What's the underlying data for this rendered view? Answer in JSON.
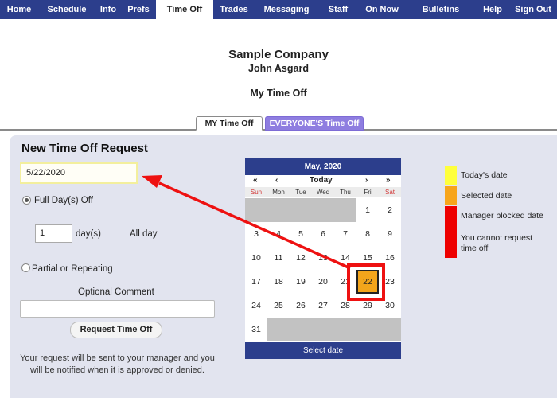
{
  "nav": {
    "items": [
      {
        "label": "Home",
        "width": 48,
        "active": false
      },
      {
        "label": "Schedule",
        "width": 72,
        "active": false
      },
      {
        "label": "Info",
        "width": 32,
        "active": false
      },
      {
        "label": "Prefs",
        "width": 44,
        "active": false
      },
      {
        "label": "Time Off",
        "width": 72,
        "active": true
      },
      {
        "label": "Trades",
        "width": 52,
        "active": false
      },
      {
        "label": "Messaging",
        "width": 80,
        "active": false
      },
      {
        "label": "Staff",
        "width": 50,
        "active": false
      },
      {
        "label": "On Now",
        "width": 60,
        "active": false
      },
      {
        "label": "Bulletins",
        "width": 88,
        "active": false
      },
      {
        "label": "Help",
        "width": 42,
        "active": false
      },
      {
        "label": "Sign Out",
        "width": 60,
        "active": false
      }
    ]
  },
  "header": {
    "company": "Sample Company",
    "user": "John Asgard",
    "title": "My Time Off"
  },
  "subtabs": {
    "mine": "MY Time Off",
    "everyone": "EVERYONE'S Time Off"
  },
  "form": {
    "title": "New Time Off Request",
    "date_value": "5/22/2020",
    "full_day_label": "Full Day(s) Off",
    "days_value": "1",
    "days_unit": "day(s)",
    "all_day": "All day",
    "partial_label": "Partial or Repeating",
    "comment_label": "Optional Comment",
    "submit_label": "Request Time Off",
    "notice": "Your request will be sent to your manager and you will be notified when it is approved or denied."
  },
  "calendar": {
    "month_label": "May, 2020",
    "nav": {
      "prev_year": "«",
      "prev_month": "‹",
      "today": "Today",
      "next_month": "›",
      "next_year": "»"
    },
    "days_of_week": [
      "Sun",
      "Mon",
      "Tue",
      "Wed",
      "Thu",
      "Fri",
      "Sat"
    ],
    "weeks": [
      [
        "",
        "",
        "",
        "",
        "",
        "1",
        "2"
      ],
      [
        "3",
        "4",
        "5",
        "6",
        "7",
        "8",
        "9"
      ],
      [
        "10",
        "11",
        "12",
        "13",
        "14",
        "15",
        "16"
      ],
      [
        "17",
        "18",
        "19",
        "20",
        "21",
        "22",
        "23"
      ],
      [
        "24",
        "25",
        "26",
        "27",
        "28",
        "29",
        "30"
      ],
      [
        "31",
        "",
        "",
        "",
        "",
        "",
        ""
      ]
    ],
    "selected_day": "22",
    "footer": "Select date",
    "colors": {
      "header": "#2c3e8c",
      "blank": "#c2c2c2",
      "selected": "#f3a51b"
    }
  },
  "legend": {
    "todays_date": "Today's date",
    "selected_date": "Selected date",
    "blocked": "Manager blocked date",
    "blocked_note": "You cannot request time off",
    "colors": {
      "today": "#ffff3c",
      "selected": "#f7a51b",
      "blocked": "#ee0000"
    }
  },
  "annotation": {
    "color": "#ee1111"
  }
}
